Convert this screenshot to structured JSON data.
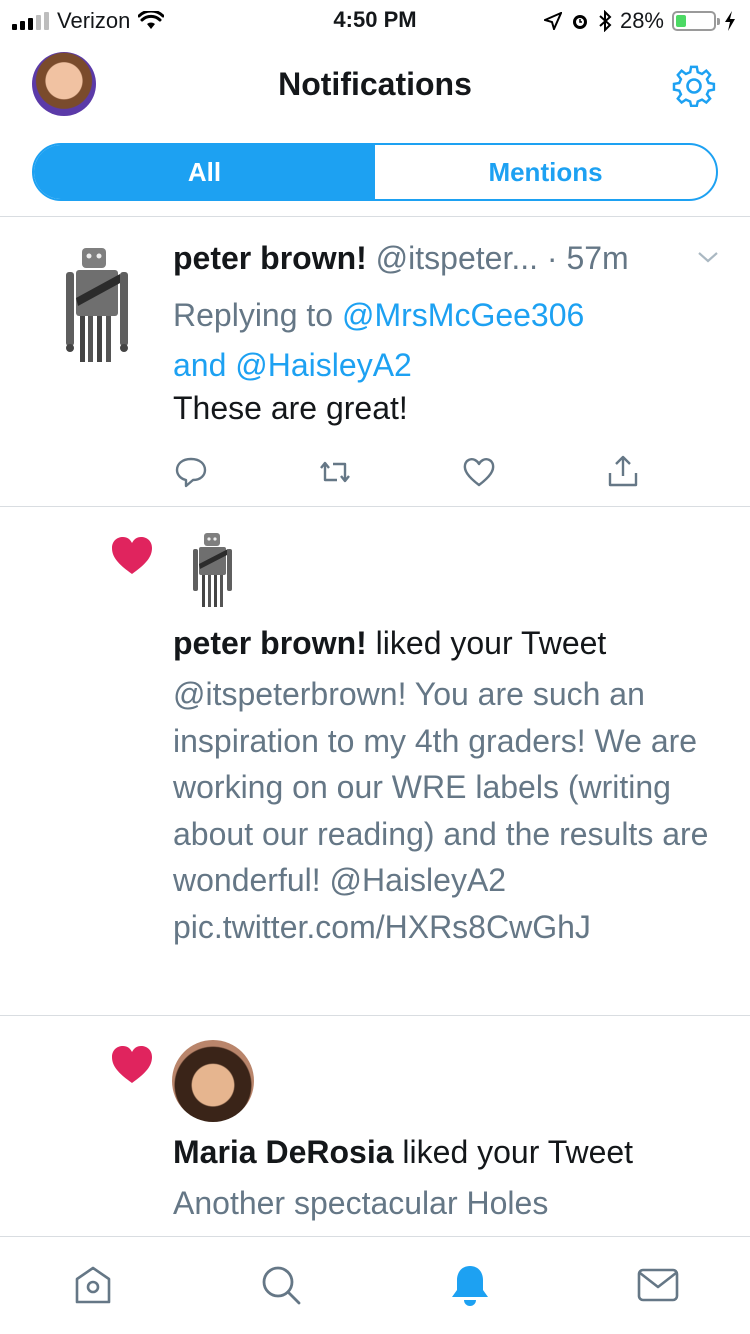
{
  "status_bar": {
    "carrier": "Verizon",
    "time": "4:50 PM",
    "battery_percent": "28%",
    "battery_level": 0.28,
    "battery_color": "#4cd964"
  },
  "header": {
    "title": "Notifications",
    "avatar_icon": "profile-avatar",
    "settings_icon": "gear-icon"
  },
  "tabs": [
    {
      "label": "All",
      "active": true
    },
    {
      "label": "Mentions",
      "active": false
    }
  ],
  "tweet": {
    "name": "peter brown!",
    "handle": "@itspeter...",
    "time": "· 57m",
    "reply_prefix": "Replying to",
    "reply_user1": "@MrsMcGee306",
    "reply_and": "and",
    "reply_user2": "@HaisleyA2",
    "text": "These are great!",
    "actions": [
      "reply-icon",
      "retweet-icon",
      "like-icon",
      "share-icon"
    ]
  },
  "notifications": [
    {
      "name": "peter brown!",
      "action": "liked your Tweet",
      "body": "@itspeterbrown! You are such an inspiration to my 4th graders! We are working on our WRE labels (writing about our reading) and the results are wonderful! @HaisleyA2 pic.twitter.com/HXRs8CwGhJ"
    },
    {
      "name": "Maria DeRosia",
      "action": "liked your Tweet",
      "body": "Another spectacular Holes"
    }
  ],
  "tab_bar": [
    "home-icon",
    "search-icon",
    "notifications-icon",
    "messages-icon"
  ],
  "colors": {
    "accent": "#1da1f2",
    "heart": "#e0245e",
    "secondary_text": "#657786"
  }
}
